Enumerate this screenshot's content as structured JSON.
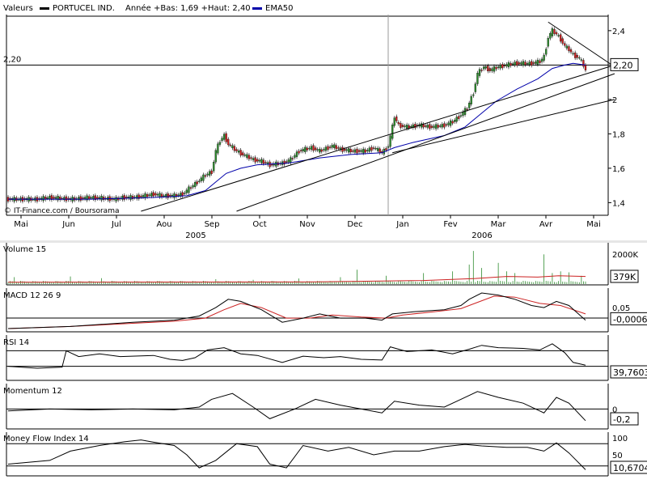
{
  "header": {
    "label_valeurs": "Valeurs",
    "ticker": "PORTUCEL IND.",
    "stats": "Année +Bas: 1,69 +Haut: 2,40",
    "ema_legend": "EMA50"
  },
  "credit": "© IT-Finance.com / Boursorama",
  "colors": {
    "up": "#2e8b2e",
    "down": "#cc2222",
    "ema": "#0000aa",
    "signal": "#cc2222",
    "grid": "#000000",
    "panel_bg": "#ffffff",
    "gap": "#e6e6e6"
  },
  "chart_data": [
    {
      "type": "candlestick",
      "title": "PORTUCEL IND.",
      "x_labels": [
        "Mai",
        "Jun",
        "Jul",
        "Aou",
        "Sep",
        "Oct",
        "Nov",
        "Dec",
        "Jan",
        "Fev",
        "Mar",
        "Avr",
        "Mai"
      ],
      "year_labels": [
        {
          "label": "2005",
          "after_month": 4
        },
        {
          "label": "2006",
          "after_month": 10
        }
      ],
      "ylim": [
        1.35,
        2.47
      ],
      "y_ticks": [
        1.4,
        1.6,
        1.8,
        2.0,
        2.2,
        2.4
      ],
      "y_tick_labels": [
        "1,4",
        "1,6",
        "1,8",
        "2",
        "2,2",
        "2,4"
      ],
      "reference_level": 2.2,
      "reference_label": "2,20",
      "last_value_label": "2,20",
      "price_path": [
        [
          0,
          1.42
        ],
        [
          14,
          1.42
        ],
        [
          20,
          1.43
        ],
        [
          30,
          1.42
        ],
        [
          40,
          1.43
        ],
        [
          52,
          1.42
        ],
        [
          55,
          1.43
        ],
        [
          60,
          1.43
        ],
        [
          66,
          1.44
        ],
        [
          70,
          1.45
        ],
        [
          74,
          1.44
        ],
        [
          80,
          1.44
        ],
        [
          84,
          1.45
        ],
        [
          86,
          1.47
        ],
        [
          92,
          1.53
        ],
        [
          95,
          1.56
        ],
        [
          98,
          1.58
        ],
        [
          100,
          1.7
        ],
        [
          102,
          1.76
        ],
        [
          104,
          1.79
        ],
        [
          106,
          1.74
        ],
        [
          110,
          1.7
        ],
        [
          113,
          1.68
        ],
        [
          118,
          1.65
        ],
        [
          122,
          1.64
        ],
        [
          126,
          1.62
        ],
        [
          132,
          1.63
        ],
        [
          136,
          1.65
        ],
        [
          140,
          1.7
        ],
        [
          146,
          1.72
        ],
        [
          150,
          1.7
        ],
        [
          156,
          1.73
        ],
        [
          160,
          1.71
        ],
        [
          166,
          1.7
        ],
        [
          172,
          1.7
        ],
        [
          176,
          1.72
        ],
        [
          180,
          1.69
        ],
        [
          183,
          1.73
        ],
        [
          185,
          1.84
        ],
        [
          186,
          1.9
        ],
        [
          188,
          1.85
        ],
        [
          192,
          1.84
        ],
        [
          198,
          1.85
        ],
        [
          204,
          1.84
        ],
        [
          210,
          1.85
        ],
        [
          214,
          1.87
        ],
        [
          218,
          1.91
        ],
        [
          221,
          1.95
        ],
        [
          224,
          2.04
        ],
        [
          226,
          2.15
        ],
        [
          229,
          2.19
        ],
        [
          232,
          2.17
        ],
        [
          236,
          2.19
        ],
        [
          240,
          2.2
        ],
        [
          244,
          2.21
        ],
        [
          248,
          2.21
        ],
        [
          252,
          2.21
        ],
        [
          256,
          2.22
        ],
        [
          258,
          2.25
        ],
        [
          260,
          2.36
        ],
        [
          262,
          2.4
        ],
        [
          264,
          2.38
        ],
        [
          266,
          2.35
        ],
        [
          268,
          2.31
        ],
        [
          270,
          2.29
        ],
        [
          272,
          2.26
        ],
        [
          275,
          2.24
        ],
        [
          277,
          2.2
        ],
        [
          278,
          2.17
        ]
      ],
      "ema_path": [
        [
          0,
          1.42
        ],
        [
          40,
          1.42
        ],
        [
          70,
          1.43
        ],
        [
          86,
          1.44
        ],
        [
          95,
          1.47
        ],
        [
          100,
          1.52
        ],
        [
          105,
          1.57
        ],
        [
          112,
          1.6
        ],
        [
          120,
          1.62
        ],
        [
          135,
          1.63
        ],
        [
          150,
          1.66
        ],
        [
          165,
          1.68
        ],
        [
          180,
          1.69
        ],
        [
          186,
          1.72
        ],
        [
          195,
          1.75
        ],
        [
          210,
          1.79
        ],
        [
          220,
          1.84
        ],
        [
          226,
          1.9
        ],
        [
          235,
          1.99
        ],
        [
          245,
          2.06
        ],
        [
          255,
          2.12
        ],
        [
          262,
          2.18
        ],
        [
          268,
          2.2
        ],
        [
          272,
          2.21
        ],
        [
          278,
          2.2
        ]
      ],
      "trendlines": [
        {
          "name": "resistance",
          "points": [
            [
              260,
              2.45
            ],
            [
              292,
              2.19
            ]
          ]
        },
        {
          "name": "support-steep",
          "points": [
            [
              64,
              1.35
            ],
            [
              292,
              2.2
            ]
          ]
        },
        {
          "name": "support-mid",
          "points": [
            [
              110,
              1.35
            ],
            [
              292,
              2.15
            ]
          ]
        },
        {
          "name": "support-low",
          "points": [
            [
              185,
              1.69
            ],
            [
              292,
              2.0
            ]
          ]
        }
      ],
      "vline_day": 183
    },
    {
      "type": "bar",
      "title": "Volume 15",
      "y_tick_labels": [
        "2000K"
      ],
      "last_value_label": "379K",
      "spikes": [
        [
          3,
          0.18
        ],
        [
          30,
          0.2
        ],
        [
          45,
          0.15
        ],
        [
          100,
          0.12
        ],
        [
          118,
          0.1
        ],
        [
          140,
          0.14
        ],
        [
          160,
          0.18
        ],
        [
          168,
          0.4
        ],
        [
          182,
          0.22
        ],
        [
          200,
          0.3
        ],
        [
          214,
          0.35
        ],
        [
          222,
          0.55
        ],
        [
          224,
          0.95
        ],
        [
          228,
          0.45
        ],
        [
          236,
          0.6
        ],
        [
          240,
          0.35
        ],
        [
          244,
          0.3
        ],
        [
          258,
          0.85
        ],
        [
          262,
          0.3
        ],
        [
          266,
          0.35
        ],
        [
          270,
          0.32
        ],
        [
          276,
          0.22
        ]
      ],
      "ma_path": [
        [
          0,
          0.03
        ],
        [
          150,
          0.04
        ],
        [
          200,
          0.08
        ],
        [
          225,
          0.14
        ],
        [
          240,
          0.2
        ],
        [
          255,
          0.18
        ],
        [
          265,
          0.22
        ],
        [
          278,
          0.2
        ]
      ]
    },
    {
      "type": "line",
      "title": "MACD 12 26 9",
      "y_tick_labels": [
        "0,05"
      ],
      "last_value_label": "-0,0006",
      "ylim": [
        -0.05,
        0.12
      ],
      "macd_path": [
        [
          0,
          -0.05
        ],
        [
          30,
          -0.04
        ],
        [
          60,
          -0.02
        ],
        [
          80,
          -0.01
        ],
        [
          92,
          0.01
        ],
        [
          100,
          0.05
        ],
        [
          106,
          0.09
        ],
        [
          112,
          0.08
        ],
        [
          122,
          0.04
        ],
        [
          132,
          -0.02
        ],
        [
          142,
          0.0
        ],
        [
          150,
          0.02
        ],
        [
          160,
          0.0
        ],
        [
          172,
          0.0
        ],
        [
          180,
          -0.01
        ],
        [
          185,
          0.02
        ],
        [
          195,
          0.03
        ],
        [
          210,
          0.04
        ],
        [
          218,
          0.06
        ],
        [
          222,
          0.09
        ],
        [
          228,
          0.12
        ],
        [
          236,
          0.11
        ],
        [
          244,
          0.09
        ],
        [
          252,
          0.06
        ],
        [
          258,
          0.05
        ],
        [
          264,
          0.08
        ],
        [
          270,
          0.06
        ],
        [
          278,
          -0.01
        ]
      ],
      "signal_path": [
        [
          0,
          -0.05
        ],
        [
          30,
          -0.04
        ],
        [
          60,
          -0.025
        ],
        [
          80,
          -0.015
        ],
        [
          95,
          0.0
        ],
        [
          104,
          0.04
        ],
        [
          112,
          0.07
        ],
        [
          122,
          0.05
        ],
        [
          134,
          0.0
        ],
        [
          145,
          0.0
        ],
        [
          156,
          0.015
        ],
        [
          170,
          0.005
        ],
        [
          182,
          0.0
        ],
        [
          190,
          0.015
        ],
        [
          205,
          0.03
        ],
        [
          218,
          0.045
        ],
        [
          226,
          0.075
        ],
        [
          234,
          0.105
        ],
        [
          244,
          0.1
        ],
        [
          256,
          0.07
        ],
        [
          266,
          0.06
        ],
        [
          278,
          0.02
        ]
      ]
    },
    {
      "type": "line",
      "title": "RSI 14",
      "last_value_label": "39,7603",
      "ylim": [
        0,
        100
      ],
      "path": [
        [
          0,
          30
        ],
        [
          14,
          25
        ],
        [
          26,
          28
        ],
        [
          28,
          70
        ],
        [
          34,
          55
        ],
        [
          44,
          62
        ],
        [
          54,
          55
        ],
        [
          70,
          58
        ],
        [
          78,
          48
        ],
        [
          84,
          45
        ],
        [
          90,
          52
        ],
        [
          96,
          72
        ],
        [
          104,
          78
        ],
        [
          112,
          62
        ],
        [
          120,
          58
        ],
        [
          132,
          40
        ],
        [
          142,
          56
        ],
        [
          152,
          52
        ],
        [
          160,
          55
        ],
        [
          170,
          48
        ],
        [
          180,
          46
        ],
        [
          184,
          80
        ],
        [
          192,
          68
        ],
        [
          204,
          72
        ],
        [
          214,
          62
        ],
        [
          222,
          74
        ],
        [
          228,
          84
        ],
        [
          236,
          78
        ],
        [
          248,
          76
        ],
        [
          256,
          72
        ],
        [
          262,
          88
        ],
        [
          268,
          65
        ],
        [
          272,
          40
        ],
        [
          278,
          33
        ]
      ]
    },
    {
      "type": "line",
      "title": "Momentum 12",
      "y_tick_labels": [
        "0"
      ],
      "last_value_label": "-0,2",
      "ylim": [
        -0.45,
        0.55
      ],
      "path": [
        [
          0,
          -0.05
        ],
        [
          20,
          0.0
        ],
        [
          40,
          -0.02
        ],
        [
          60,
          0.0
        ],
        [
          80,
          -0.02
        ],
        [
          92,
          0.05
        ],
        [
          98,
          0.25
        ],
        [
          108,
          0.4
        ],
        [
          118,
          0.05
        ],
        [
          126,
          -0.25
        ],
        [
          138,
          0.0
        ],
        [
          148,
          0.25
        ],
        [
          160,
          0.1
        ],
        [
          170,
          0.0
        ],
        [
          180,
          -0.1
        ],
        [
          186,
          0.2
        ],
        [
          198,
          0.1
        ],
        [
          210,
          0.05
        ],
        [
          218,
          0.25
        ],
        [
          226,
          0.45
        ],
        [
          236,
          0.3
        ],
        [
          248,
          0.15
        ],
        [
          258,
          -0.1
        ],
        [
          264,
          0.3
        ],
        [
          270,
          0.15
        ],
        [
          278,
          -0.3
        ]
      ]
    },
    {
      "type": "line",
      "title": "Money Flow Index 14",
      "y_tick_labels": [
        "100",
        "50"
      ],
      "last_value_label": "10,6704",
      "ylim": [
        0,
        100
      ],
      "path": [
        [
          0,
          25
        ],
        [
          20,
          35
        ],
        [
          30,
          60
        ],
        [
          44,
          75
        ],
        [
          56,
          85
        ],
        [
          64,
          90
        ],
        [
          70,
          84
        ],
        [
          80,
          75
        ],
        [
          86,
          50
        ],
        [
          92,
          15
        ],
        [
          100,
          35
        ],
        [
          110,
          80
        ],
        [
          120,
          72
        ],
        [
          126,
          25
        ],
        [
          134,
          15
        ],
        [
          142,
          75
        ],
        [
          154,
          60
        ],
        [
          164,
          70
        ],
        [
          176,
          50
        ],
        [
          186,
          60
        ],
        [
          198,
          60
        ],
        [
          210,
          72
        ],
        [
          220,
          78
        ],
        [
          228,
          74
        ],
        [
          240,
          70
        ],
        [
          250,
          70
        ],
        [
          258,
          60
        ],
        [
          264,
          82
        ],
        [
          270,
          55
        ],
        [
          278,
          10
        ]
      ]
    }
  ]
}
